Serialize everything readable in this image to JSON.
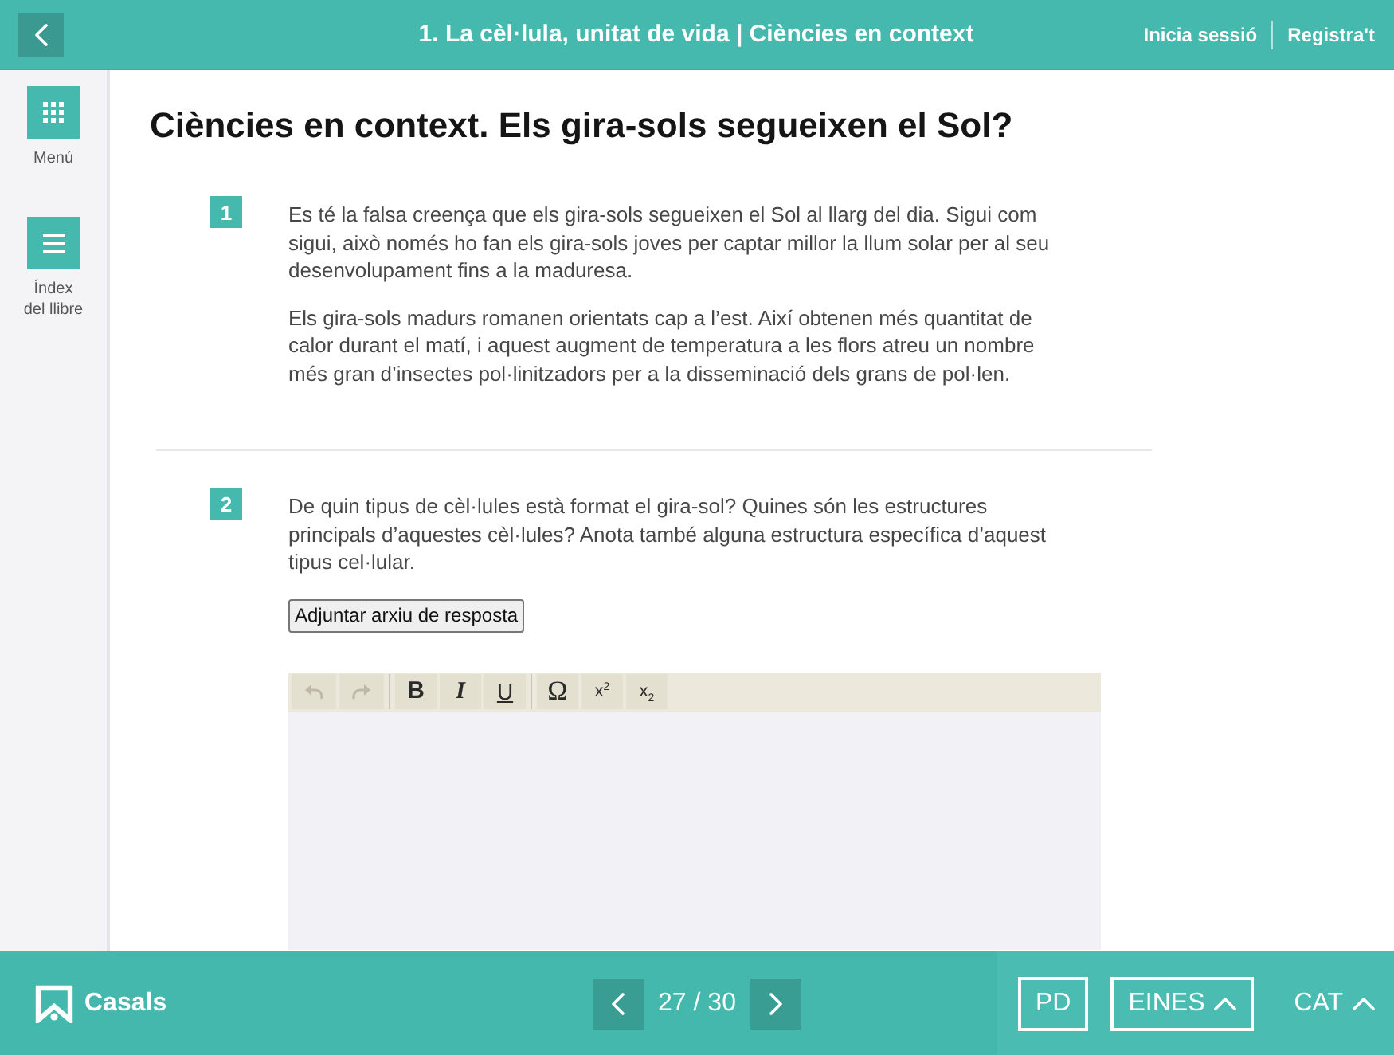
{
  "top_bar": {
    "title": "1. La cèl·lula, unitat de vida | Ciències en context",
    "links": [
      {
        "label": "Inicia sessió"
      },
      {
        "label": "Registra't"
      }
    ]
  },
  "sidebar": {
    "items": [
      {
        "kind": "grid",
        "label": "Menú"
      },
      {
        "kind": "list",
        "label": "Índex del llibre"
      }
    ]
  },
  "page": {
    "title": "Ciències en context. Els gira-sols segueixen el Sol?",
    "questions": [
      {
        "number": "1",
        "paragraphs": [
          "Es té la falsa creença que els gira-sols segueixen el Sol al llarg del dia. Sigui com sigui, això només ho fan els gira-sols joves per captar millor la llum solar per al seu desenvolupament fins a la maduresa.",
          "Els gira-sols madurs romanen orientats cap a l’est. Així obtenen més quantitat de calor durant el matí, i aquest augment de temperatura a les flors atreu un nombre més gran d’insectes pol·linitzadors per a la disseminació dels grans de pol·len."
        ]
      },
      {
        "number": "2",
        "paragraphs": [
          "De quin tipus de cèl·lules està format el gira-sol? Quines són les estructures principals d’aquestes cèl·lules? Anota també alguna estructura específica d’aquest tipus cel·lular."
        ],
        "attach_button": "Adjuntar arxiu de resposta",
        "editor": {
          "toolbar": [
            {
              "items": [
                {
                  "kind": "undo",
                  "disabled": true
                },
                {
                  "kind": "redo",
                  "disabled": true
                }
              ]
            },
            {
              "items": [
                {
                  "kind": "bold",
                  "label": "B",
                  "disabled": false
                },
                {
                  "kind": "italic",
                  "label": "I",
                  "disabled": false
                },
                {
                  "kind": "underline",
                  "label": "U",
                  "disabled": false
                }
              ]
            },
            {
              "items": [
                {
                  "kind": "symbol",
                  "label": "Ω",
                  "disabled": false
                },
                {
                  "kind": "superscript",
                  "label": "x$^{2}$",
                  "disabled": false
                },
                {
                  "kind": "subscript",
                  "label": "x$_{2}$",
                  "disabled": false
                }
              ]
            }
          ]
        }
      }
    ]
  },
  "bottom_bar": {
    "brand": "Casals",
    "pager": {
      "label": "27 / 30"
    },
    "buttons": [
      {
        "kind": "plain",
        "label": "PD",
        "outlined": true
      },
      {
        "kind": "menu",
        "label": "EINES",
        "outlined": true
      },
      {
        "kind": "menu",
        "label": "CAT",
        "outlined": false
      }
    ]
  }
}
